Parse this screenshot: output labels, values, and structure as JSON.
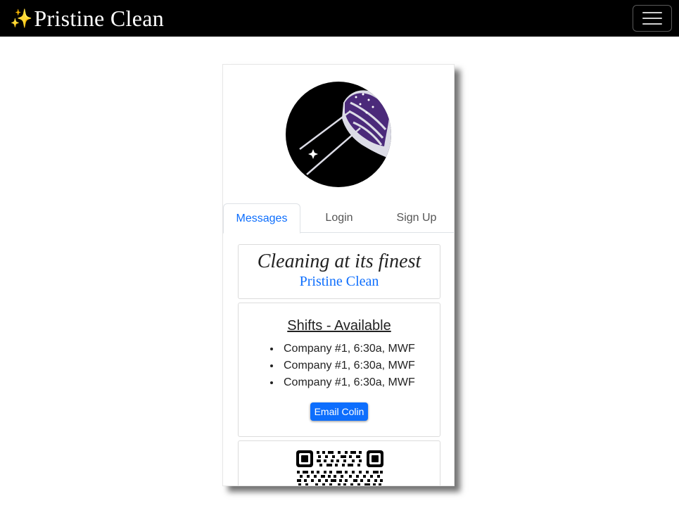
{
  "navbar": {
    "brand_icon": "sparkles-icon",
    "brand_name": "Pristine Clean",
    "toggler_icon": "hamburger-menu-icon"
  },
  "colors": {
    "navbar_bg": "#000000",
    "accent": "#0d6efd",
    "logo_bg": "#000000",
    "logo_purple": "#4b2a7a"
  },
  "tabs": [
    {
      "label": "Messages",
      "active": true
    },
    {
      "label": "Login",
      "active": false
    },
    {
      "label": "Sign Up",
      "active": false
    }
  ],
  "hero": {
    "tagline": "Cleaning at its finest",
    "brand": "Pristine Clean"
  },
  "shifts": {
    "title": "Shifts - Available",
    "items": [
      "Company #1, 6:30a, MWF",
      "Company #1, 6:30a, MWF",
      "Company #1, 6:30a, MWF"
    ],
    "button_label": "Email Colin"
  }
}
